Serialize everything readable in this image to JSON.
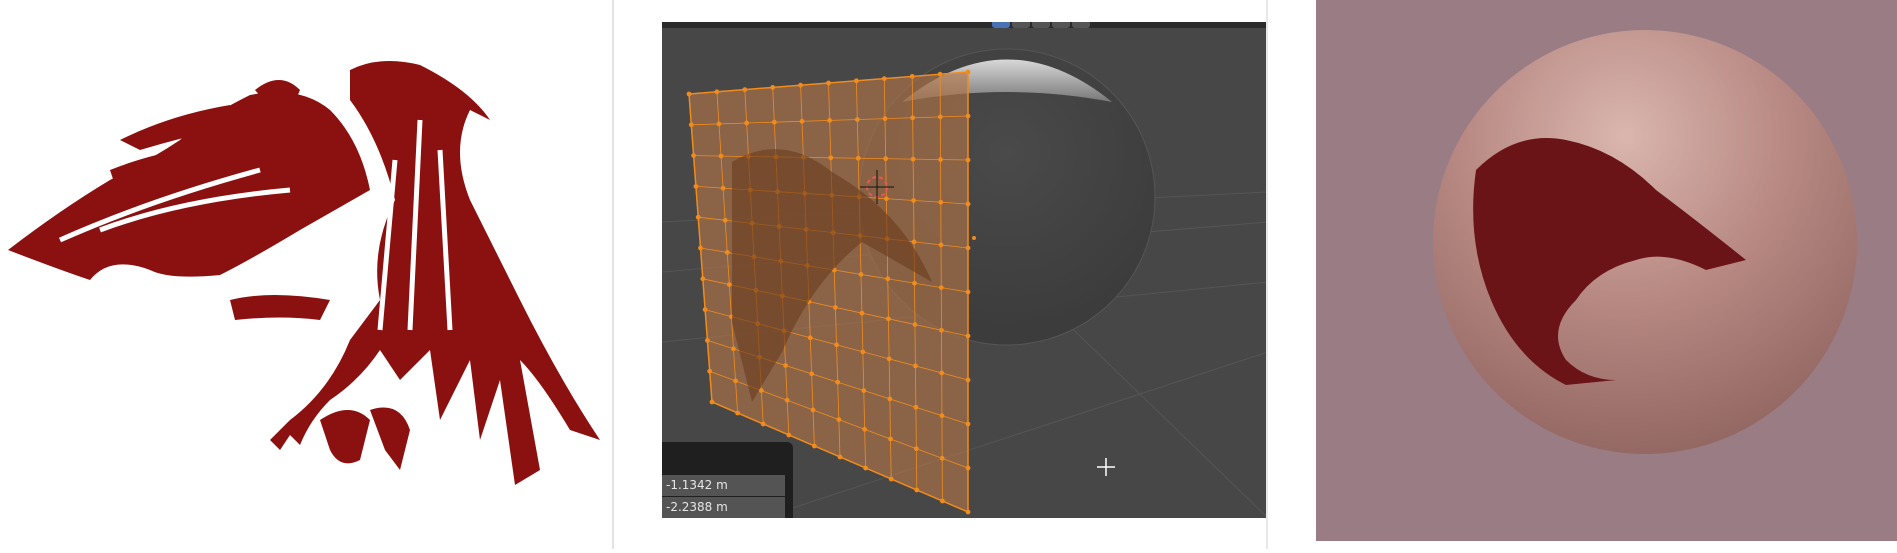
{
  "panels": {
    "left": {
      "label": "Raven decal image"
    },
    "viewport": {
      "redo_panel": {
        "fields": [
          "-1.1342 m",
          "-2.2388 m"
        ]
      },
      "icons": [
        "cursor-3d-icon",
        "crosshair-icon"
      ]
    },
    "right": {
      "label": "Rendered sphere with decal"
    }
  },
  "colors": {
    "decal": "#8b1111",
    "mesh": "#f08c1e",
    "viewport_bg": "#474747",
    "render_bg": "#9a7c84"
  }
}
